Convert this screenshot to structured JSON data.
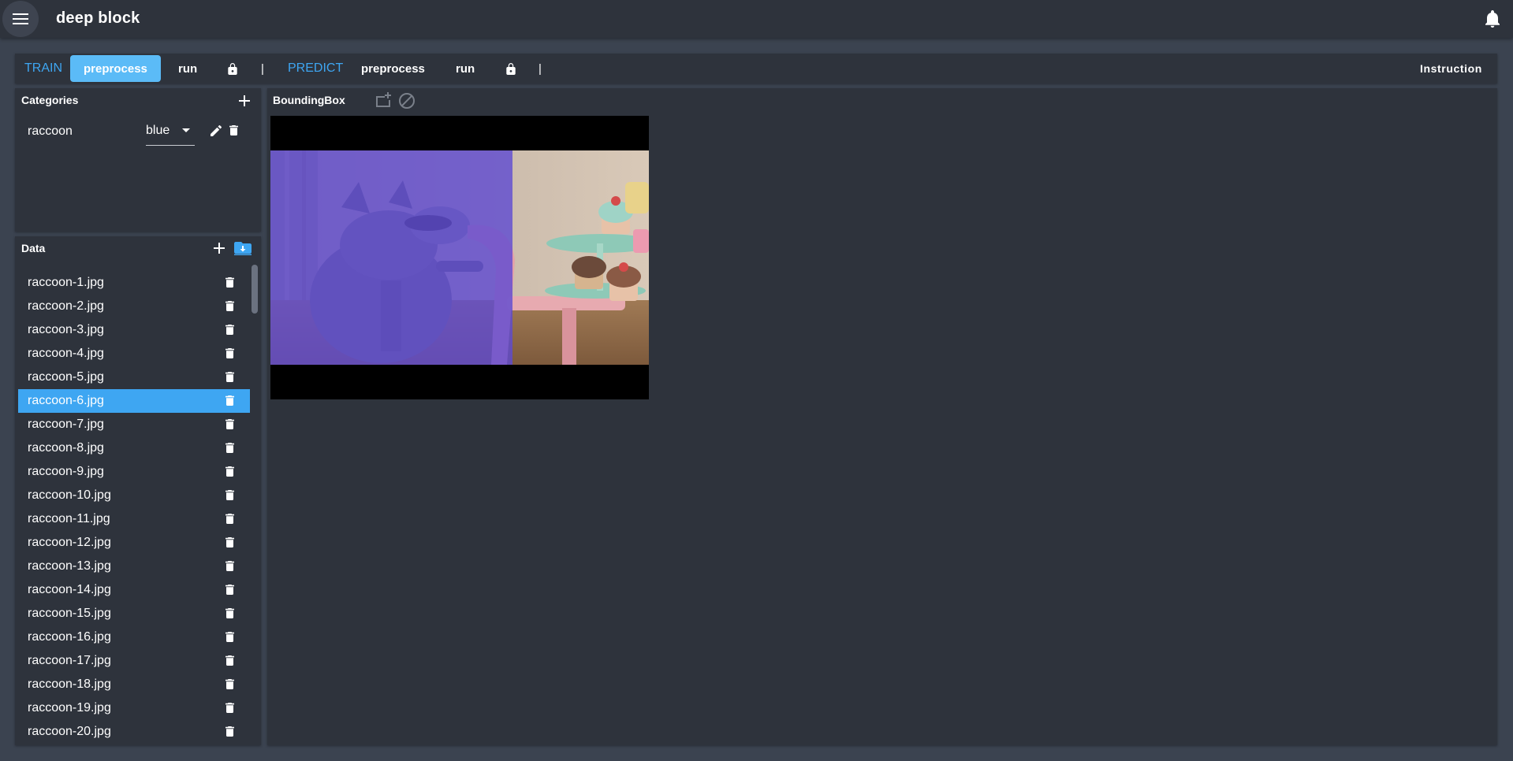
{
  "app": {
    "title": "deep block",
    "menu_icon": "hamburger-icon",
    "notification_icon": "bell-icon"
  },
  "toolbar": {
    "train_label": "TRAIN",
    "train_preprocess": "preprocess",
    "train_run": "run",
    "predict_label": "PREDICT",
    "predict_preprocess": "preprocess",
    "predict_run": "run",
    "separator": "|",
    "instruction": "Instruction",
    "lock_icon": "lock-icon"
  },
  "categories": {
    "title": "Categories",
    "items": [
      {
        "name": "raccoon",
        "color": "blue"
      }
    ]
  },
  "data": {
    "title": "Data",
    "selected": "raccoon-6.jpg",
    "files": [
      "raccoon-1.jpg",
      "raccoon-2.jpg",
      "raccoon-3.jpg",
      "raccoon-4.jpg",
      "raccoon-5.jpg",
      "raccoon-6.jpg",
      "raccoon-7.jpg",
      "raccoon-8.jpg",
      "raccoon-9.jpg",
      "raccoon-10.jpg",
      "raccoon-11.jpg",
      "raccoon-12.jpg",
      "raccoon-13.jpg",
      "raccoon-14.jpg",
      "raccoon-15.jpg",
      "raccoon-16.jpg",
      "raccoon-17.jpg",
      "raccoon-18.jpg",
      "raccoon-19.jpg",
      "raccoon-20.jpg"
    ]
  },
  "editor": {
    "title": "BoundingBox",
    "tool_add_icon": "add-box-icon",
    "tool_clear_icon": "block-icon",
    "overlay_color": "#5e4ad2"
  },
  "colors": {
    "accent": "#3ea6f2",
    "active_button": "#5bbbf7",
    "panel": "#2e333c",
    "background": "#3b4350"
  }
}
